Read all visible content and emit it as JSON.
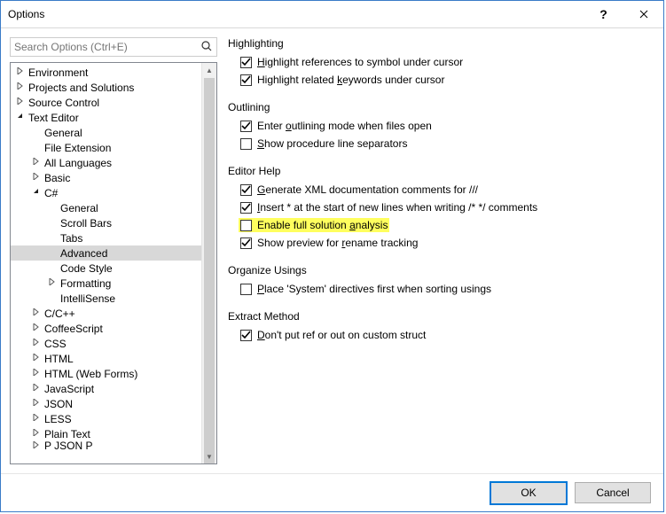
{
  "window": {
    "title": "Options"
  },
  "search": {
    "placeholder": "Search Options (Ctrl+E)"
  },
  "tree": [
    {
      "label": "Environment",
      "depth": 0,
      "twist": "collapsed"
    },
    {
      "label": "Projects and Solutions",
      "depth": 0,
      "twist": "collapsed"
    },
    {
      "label": "Source Control",
      "depth": 0,
      "twist": "collapsed"
    },
    {
      "label": "Text Editor",
      "depth": 0,
      "twist": "expanded"
    },
    {
      "label": "General",
      "depth": 1,
      "twist": "none"
    },
    {
      "label": "File Extension",
      "depth": 1,
      "twist": "none"
    },
    {
      "label": "All Languages",
      "depth": 1,
      "twist": "collapsed"
    },
    {
      "label": "Basic",
      "depth": 1,
      "twist": "collapsed"
    },
    {
      "label": "C#",
      "depth": 1,
      "twist": "expanded"
    },
    {
      "label": "General",
      "depth": 2,
      "twist": "none"
    },
    {
      "label": "Scroll Bars",
      "depth": 2,
      "twist": "none"
    },
    {
      "label": "Tabs",
      "depth": 2,
      "twist": "none"
    },
    {
      "label": "Advanced",
      "depth": 2,
      "twist": "none",
      "selected": true
    },
    {
      "label": "Code Style",
      "depth": 2,
      "twist": "none"
    },
    {
      "label": "Formatting",
      "depth": 2,
      "twist": "collapsed"
    },
    {
      "label": "IntelliSense",
      "depth": 2,
      "twist": "none"
    },
    {
      "label": "C/C++",
      "depth": 1,
      "twist": "collapsed"
    },
    {
      "label": "CoffeeScript",
      "depth": 1,
      "twist": "collapsed"
    },
    {
      "label": "CSS",
      "depth": 1,
      "twist": "collapsed"
    },
    {
      "label": "HTML",
      "depth": 1,
      "twist": "collapsed"
    },
    {
      "label": "HTML (Web Forms)",
      "depth": 1,
      "twist": "collapsed"
    },
    {
      "label": "JavaScript",
      "depth": 1,
      "twist": "collapsed"
    },
    {
      "label": "JSON",
      "depth": 1,
      "twist": "collapsed"
    },
    {
      "label": "LESS",
      "depth": 1,
      "twist": "collapsed"
    },
    {
      "label": "Plain Text",
      "depth": 1,
      "twist": "collapsed"
    },
    {
      "label": "P   JSON P",
      "depth": 1,
      "twist": "collapsed",
      "cut": true
    }
  ],
  "groups": {
    "highlighting": {
      "title": "Highlighting",
      "items": [
        {
          "checked": true,
          "pre": "",
          "u": "H",
          "post": "ighlight references to symbol under cursor"
        },
        {
          "checked": true,
          "pre": "Highlight related ",
          "u": "k",
          "post": "eywords under cursor"
        }
      ]
    },
    "outlining": {
      "title": "Outlining",
      "items": [
        {
          "checked": true,
          "pre": "Enter ",
          "u": "o",
          "post": "utlining mode when files open"
        },
        {
          "checked": false,
          "pre": "",
          "u": "S",
          "post": "how procedure line separators"
        }
      ]
    },
    "editorhelp": {
      "title": "Editor Help",
      "items": [
        {
          "checked": true,
          "pre": "",
          "u": "G",
          "post": "enerate XML documentation comments for ///"
        },
        {
          "checked": true,
          "pre": "",
          "u": "I",
          "post": "nsert * at the start of new lines when writing /* */ comments"
        },
        {
          "checked": false,
          "pre": "Enable full solution ",
          "u": "a",
          "post": "nalysis",
          "highlight": true
        },
        {
          "checked": true,
          "pre": "Show preview for ",
          "u": "r",
          "post": "ename tracking"
        }
      ]
    },
    "organize": {
      "title": "Organize Usings",
      "items": [
        {
          "checked": false,
          "pre": "",
          "u": "P",
          "post": "lace 'System' directives first when sorting usings"
        }
      ]
    },
    "extract": {
      "title": "Extract Method",
      "items": [
        {
          "checked": true,
          "pre": "",
          "u": "D",
          "post": "on't put ref or out on custom struct"
        }
      ]
    }
  },
  "footer": {
    "ok": "OK",
    "cancel": "Cancel"
  }
}
